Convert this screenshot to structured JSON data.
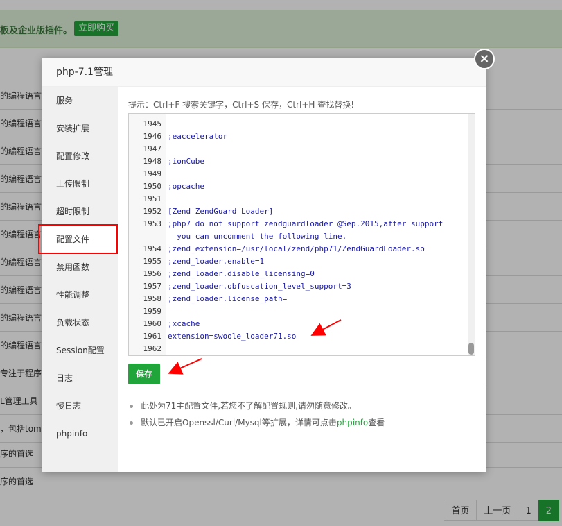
{
  "background": {
    "notice": {
      "text": "板及企业版插件。",
      "button": "立即购买"
    },
    "rows": [
      "的编程语言",
      "的编程语言",
      "的编程语言",
      "的编程语言",
      "的编程语言",
      "的编程语言",
      "的编程语言",
      "的编程语言",
      "的编程语言",
      "的编程语言",
      "专注于程序做",
      "L管理工具",
      "，包括tom",
      "序的首选",
      "序的首选"
    ],
    "pager": {
      "first": "首页",
      "prev": "上一页",
      "page1": "1",
      "page2": "2"
    }
  },
  "dialog": {
    "title": "php-7.1管理",
    "close": "×",
    "sidebar": [
      "服务",
      "安装扩展",
      "配置修改",
      "上传限制",
      "超时限制",
      "配置文件",
      "禁用函数",
      "性能调整",
      "负载状态",
      "Session配置",
      "日志",
      "慢日志",
      "phpinfo"
    ],
    "active_index": 5,
    "hint": "提示：Ctrl+F 搜索关键字，Ctrl+S 保存，Ctrl+H 查找替换!",
    "editor": {
      "lines": [
        {
          "num": "1945",
          "text": ""
        },
        {
          "num": "1946",
          "text": ";eaccelerator"
        },
        {
          "num": "1947",
          "text": ""
        },
        {
          "num": "1948",
          "text": ";ionCube"
        },
        {
          "num": "1949",
          "text": ""
        },
        {
          "num": "1950",
          "text": ";opcache"
        },
        {
          "num": "1951",
          "text": ""
        },
        {
          "num": "1952",
          "text": "[Zend ZendGuard Loader]"
        },
        {
          "num": "1953",
          "text": ";php7 do not support zendguardloader @Sep.2015,after support"
        },
        {
          "num": "",
          "text": "  you can uncomment the following line."
        },
        {
          "num": "1954",
          "text": ";zend_extension=/usr/local/zend/php71/ZendGuardLoader.so"
        },
        {
          "num": "1955",
          "text": ";zend_loader.enable=1"
        },
        {
          "num": "1956",
          "text": ";zend_loader.disable_licensing=0"
        },
        {
          "num": "1957",
          "text": ";zend_loader.obfuscation_level_support=3"
        },
        {
          "num": "1958",
          "text": ";zend_loader.license_path="
        },
        {
          "num": "1959",
          "text": ""
        },
        {
          "num": "1960",
          "text": ";xcache"
        },
        {
          "num": "1961",
          "text": "extension=swoole_loader71.so"
        },
        {
          "num": "1962",
          "text": ""
        }
      ]
    },
    "save_label": "保存",
    "notes": {
      "note1": "此处为71主配置文件,若您不了解配置规则,请勿随意修改。",
      "note2_prefix": "默认已开启Openssl/Curl/Mysql等扩展，详情可点击",
      "note2_link": "phpinfo",
      "note2_suffix": "查看"
    }
  },
  "colors": {
    "accent": "#20a53a",
    "highlight": "#ff0000",
    "notice_bg": "#dff0d8"
  }
}
